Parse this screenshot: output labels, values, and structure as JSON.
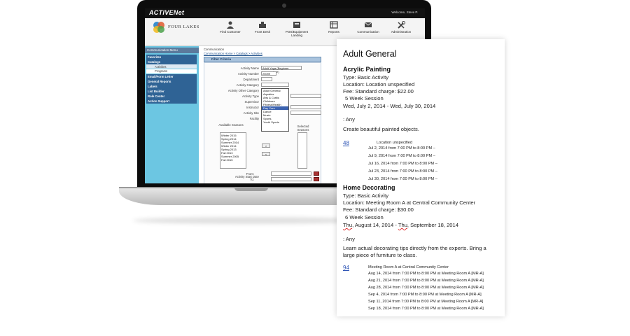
{
  "app": {
    "brand": "ACTIVENet",
    "welcome": "Welcome, Steve P.",
    "logo_text": "FOUR LAKES",
    "nav": [
      {
        "label": "Find Customer",
        "icon": "find-customer-icon"
      },
      {
        "label": "Front Desk",
        "icon": "front-desk-icon"
      },
      {
        "label": "POS/Equipment Landing",
        "icon": "pos-icon"
      },
      {
        "label": "Reports",
        "icon": "reports-icon"
      },
      {
        "label": "Communication",
        "icon": "communication-icon"
      },
      {
        "label": "Administration",
        "icon": "administration-icon"
      }
    ]
  },
  "sidebar": {
    "title": "Communication Menu",
    "items": [
      {
        "label": "Favorites",
        "type": "item"
      },
      {
        "label": "Catalogs",
        "type": "item"
      },
      {
        "label": "Activities",
        "type": "sub"
      },
      {
        "label": "Programs",
        "type": "sub"
      },
      {
        "label": "Email/Form Letter",
        "type": "item"
      },
      {
        "label": "General Reports",
        "type": "item"
      },
      {
        "label": "Labels",
        "type": "item"
      },
      {
        "label": "List Builder",
        "type": "item"
      },
      {
        "label": "Role Center",
        "type": "item"
      },
      {
        "label": "Action Support",
        "type": "item"
      }
    ]
  },
  "main": {
    "breadcrumb_title": "Communication",
    "breadcrumb_path": "Communication Home > Catalogs > Activities",
    "filter_title": "Filter Criteria",
    "fields": [
      {
        "label": "Activity Name",
        "value": "Adult Yoga (Beginner Intermediate)"
      },
      {
        "label": "Activity Number",
        "value": "25099"
      },
      {
        "label": "Department",
        "value": ""
      },
      {
        "label": "Activity Category",
        "value": ""
      },
      {
        "label": "Activity Other Category",
        "value": ""
      },
      {
        "label": "Activity Type",
        "value": ""
      },
      {
        "label": "Supervisor",
        "value": ""
      },
      {
        "label": "Instructor",
        "value": ""
      },
      {
        "label": "Activity Site",
        "value": ""
      },
      {
        "label": "Facility",
        "value": ""
      }
    ],
    "category_options": [
      "Adult General",
      "Aquatics",
      "Arts & Crafts",
      "Childcare",
      "Fitness/Health",
      "Day Care",
      "Dance",
      "Music",
      "Sports",
      "Youth Sports"
    ],
    "category_selected_index": 5,
    "available_seasons_label": "Available Seasons",
    "selected_seasons_label": "Selected Seasons",
    "seasons": [
      "Winter 2015",
      "Spring 2014",
      "Summer 2014",
      "Winter 2014",
      "Spring 2013",
      "Fall 2013",
      "Summer 2005",
      "Fall 2015"
    ],
    "start_date_label": "Activity Start Date",
    "from_label": "From:",
    "to_label": "To:"
  },
  "paper": {
    "title": "Adult General",
    "activities": [
      {
        "name": "Acrylic Painting",
        "type": "Type: Basic Activity",
        "location": "Location: Location unspecified",
        "fee": "Fee: Standard charge: $22.00",
        "session": "5 Week Session",
        "dates": "Wed, July 2, 2014 - Wed, July 30, 2014",
        "age": ":  Any",
        "description": "Create beautiful painted objects.",
        "number": "48",
        "schedule_location": "Location unspecified",
        "schedule": [
          "Jul 2, 2014 from 7:00 PM to 8:00 PM –",
          "Jul 9, 2014 from 7:00 PM to 8:00 PM –",
          "Jul 16, 2014 from 7:00 PM to 8:00 PM –",
          "Jul 23, 2014 from 7:00 PM to 8:00 PM –",
          "Jul 30, 2014 from 7:00 PM to 8:00 PM –"
        ]
      },
      {
        "name": "Home Decorating",
        "type": "Type: Basic Activity",
        "location": "Location: Meeting Room A at Central Community Center",
        "fee": "Fee: Standard charge: $30.00",
        "session": "6 Week Session",
        "dates_prefix": "Thu",
        "dates_mid": ", August 14, 2014 - ",
        "dates_prefix2": "Thu",
        "dates_end": ", September 18, 2014",
        "age": ":  Any",
        "description_line1": "Learn actual decorating tips directly from the experts. Bring a",
        "description_line2": "large piece of furniture to class.",
        "number": "94",
        "schedule_location": "Meeting Room A at Central Community Center",
        "schedule": [
          "Aug 14, 2014 from 7:00 PM to 8:00 PM at Meeting Room A [MR-A]",
          "Aug 21, 2014 from 7:00 PM to 8:00 PM at Meeting Room A [MR-A]",
          "Aug 28, 2014 from 7:00 PM to 8:00 PM at Meeting Room A [MR-A]",
          "Sep 4, 2014 from 7:00 PM to 8:00 PM at Meeting Room A [MR-A]",
          "Sep 11, 2014 from 7:00 PM to 8:00 PM at Meeting Room A [MR-A]",
          "Sep 18, 2014 from 7:00 PM to 8:00 PM at Meeting Room A [MR-A]"
        ]
      }
    ]
  }
}
